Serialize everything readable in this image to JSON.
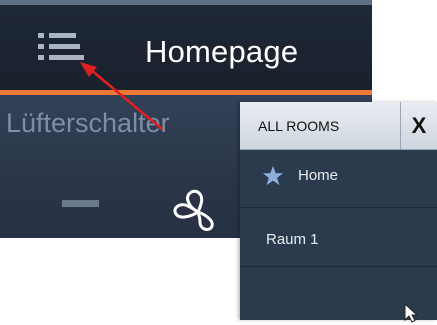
{
  "header": {
    "title": "Homepage"
  },
  "widget": {
    "label": "Lüfterschalter"
  },
  "rooms_panel": {
    "title": "ALL ROOMS",
    "close_label": "X",
    "items": [
      {
        "label": "Home",
        "icon": "star-icon"
      },
      {
        "label": "Raum 1"
      },
      {
        "label": ""
      }
    ]
  },
  "colors": {
    "accent": "#ee7a35",
    "annotation_arrow": "#e02020",
    "topbar": "#1f2836",
    "panel": "#2c3a4e"
  },
  "icons": {
    "menu": "hamburger-menu-icon",
    "fan": "fan-icon",
    "minus": "minus-icon",
    "cursor": "mouse-cursor-icon"
  }
}
